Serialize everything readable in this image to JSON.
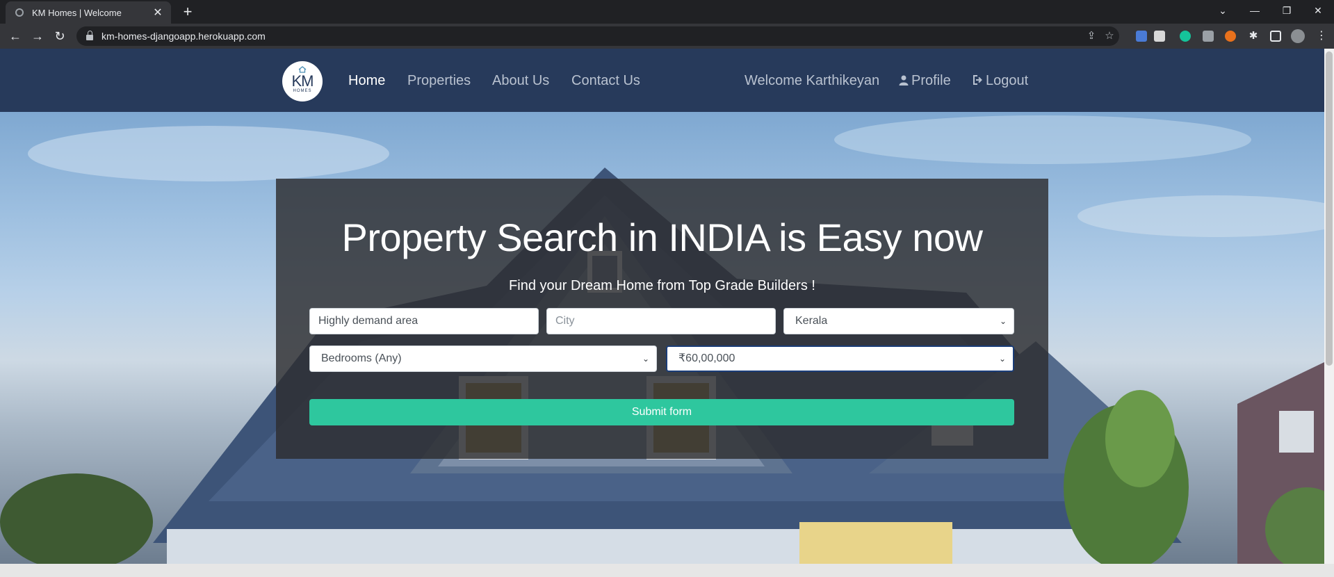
{
  "browser": {
    "tab_title": "KM Homes | Welcome",
    "url": "km-homes-djangoapp.herokuapp.com",
    "new_tab_glyph": "+",
    "close_glyph": "✕",
    "icons": [
      "back-icon",
      "forward-icon",
      "reload-icon",
      "lock-icon",
      "share-icon",
      "star-icon",
      "extensions-icon",
      "side-panel-icon",
      "profile-avatar"
    ]
  },
  "navbar": {
    "logo_text": "KM",
    "logo_sub": "HOMES",
    "links": [
      "Home",
      "Properties",
      "About Us",
      "Contact Us"
    ],
    "welcome": "Welcome Karthikeyan",
    "profile": "Profile",
    "logout": "Logout",
    "bg_color": "#273a5b"
  },
  "hero": {
    "title": "Property Search in INDIA is Easy now",
    "lead": "Find your Dream Home from Top Grade Builders !"
  },
  "form": {
    "keywords_value": "Highly demand area",
    "city_placeholder": "City",
    "state_selected": "Kerala",
    "bedrooms_selected": "Bedrooms (Any)",
    "price_selected": "₹60,00,000",
    "submit_label": "Submit form",
    "submit_color": "#2ec79e"
  }
}
